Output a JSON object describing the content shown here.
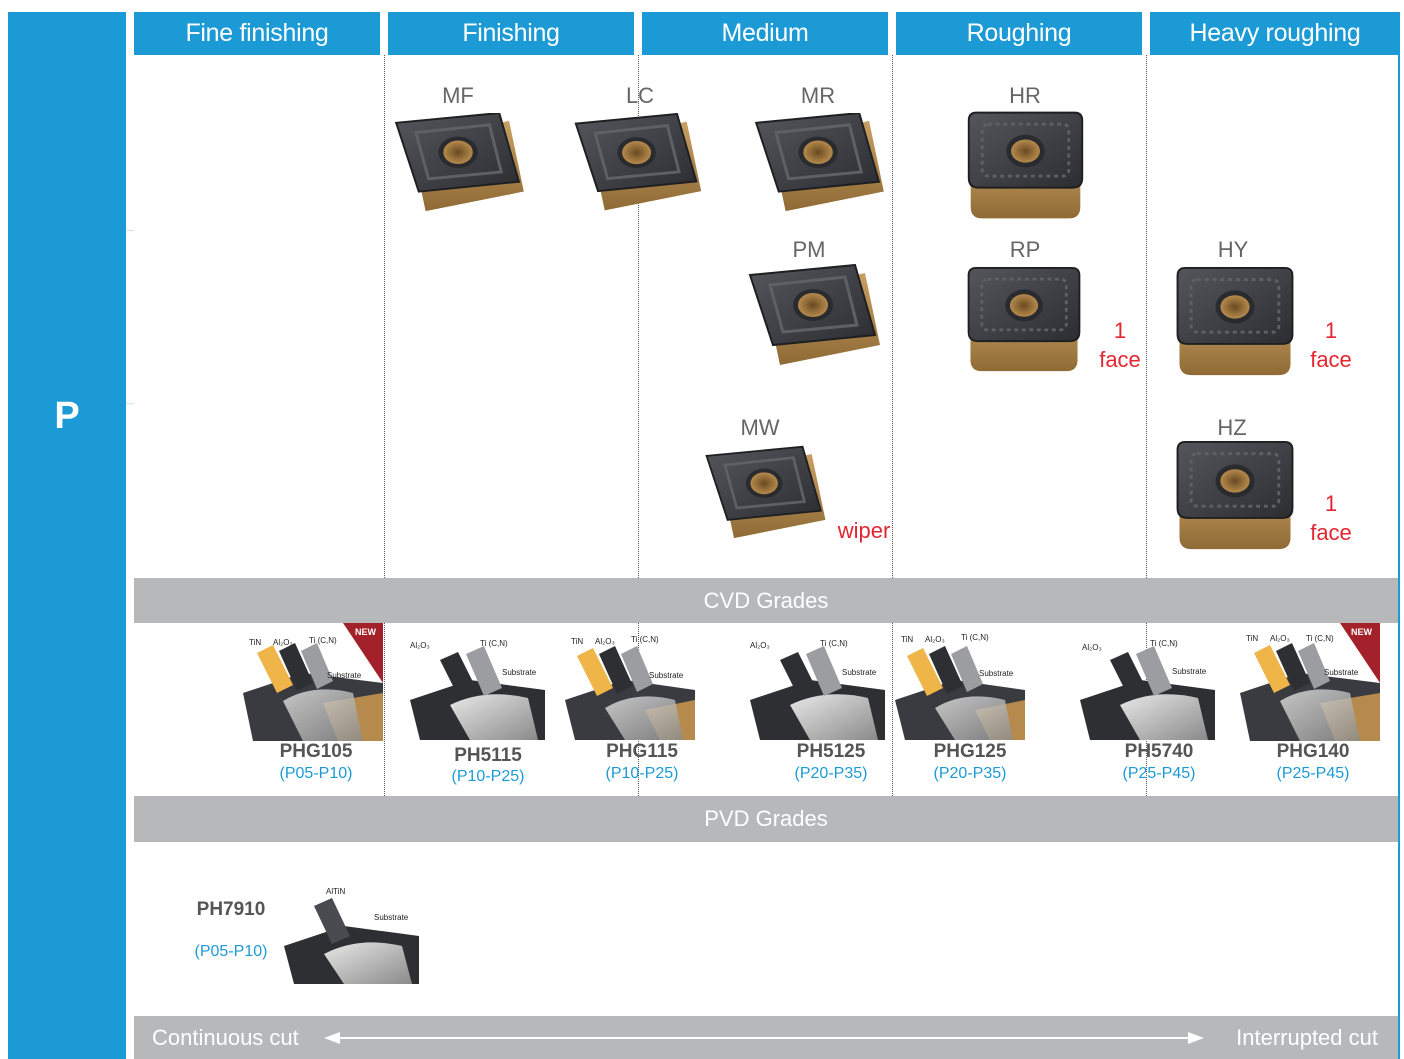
{
  "side_label": "P",
  "headers": [
    "Fine finishing",
    "Finishing",
    "Medium",
    "Roughing",
    "Heavy roughing"
  ],
  "geometries": [
    {
      "code": "MF",
      "note": ""
    },
    {
      "code": "LC",
      "note": ""
    },
    {
      "code": "MR",
      "note": ""
    },
    {
      "code": "HR",
      "note": ""
    },
    {
      "code": "PM",
      "note": ""
    },
    {
      "code": "RP",
      "note_line1": "1",
      "note_line2": "face"
    },
    {
      "code": "HY",
      "note_line1": "1",
      "note_line2": "face"
    },
    {
      "code": "MW",
      "note": "wiper"
    },
    {
      "code": "HZ",
      "note_line1": "1",
      "note_line2": "face"
    }
  ],
  "sections": {
    "cvd": "CVD Grades",
    "pvd": "PVD Grades"
  },
  "layer_labels": {
    "tin": "TiN",
    "al2o3": "Al₂O₃",
    "ticn": "Ti (C,N)",
    "substrate": "Substrate",
    "altin": "AlTiN",
    "new_badge": "NEW"
  },
  "cvd_grades": [
    {
      "name": "PHG105",
      "range": "(P05-P10)"
    },
    {
      "name": "PH5115",
      "range": "(P10-P25)"
    },
    {
      "name": "PHG115",
      "range": "(P10-P25)"
    },
    {
      "name": "PH5125",
      "range": "(P20-P35)"
    },
    {
      "name": "PHG125",
      "range": "(P20-P35)"
    },
    {
      "name": "PH5740",
      "range": "(P25-P45)"
    },
    {
      "name": "PHG140",
      "range": "(P25-P45)"
    }
  ],
  "pvd_grades": [
    {
      "name": "PH7910",
      "range": "(P05-P10)"
    }
  ],
  "footer": {
    "left": "Continuous cut",
    "right": "Interrupted cut"
  },
  "colors": {
    "header_blue": "#1c9ad6",
    "section_gray": "#b7b8ba",
    "note_red": "#e3262f",
    "insert_dark": "#3a3b40",
    "insert_gold": "#b58a4c"
  }
}
